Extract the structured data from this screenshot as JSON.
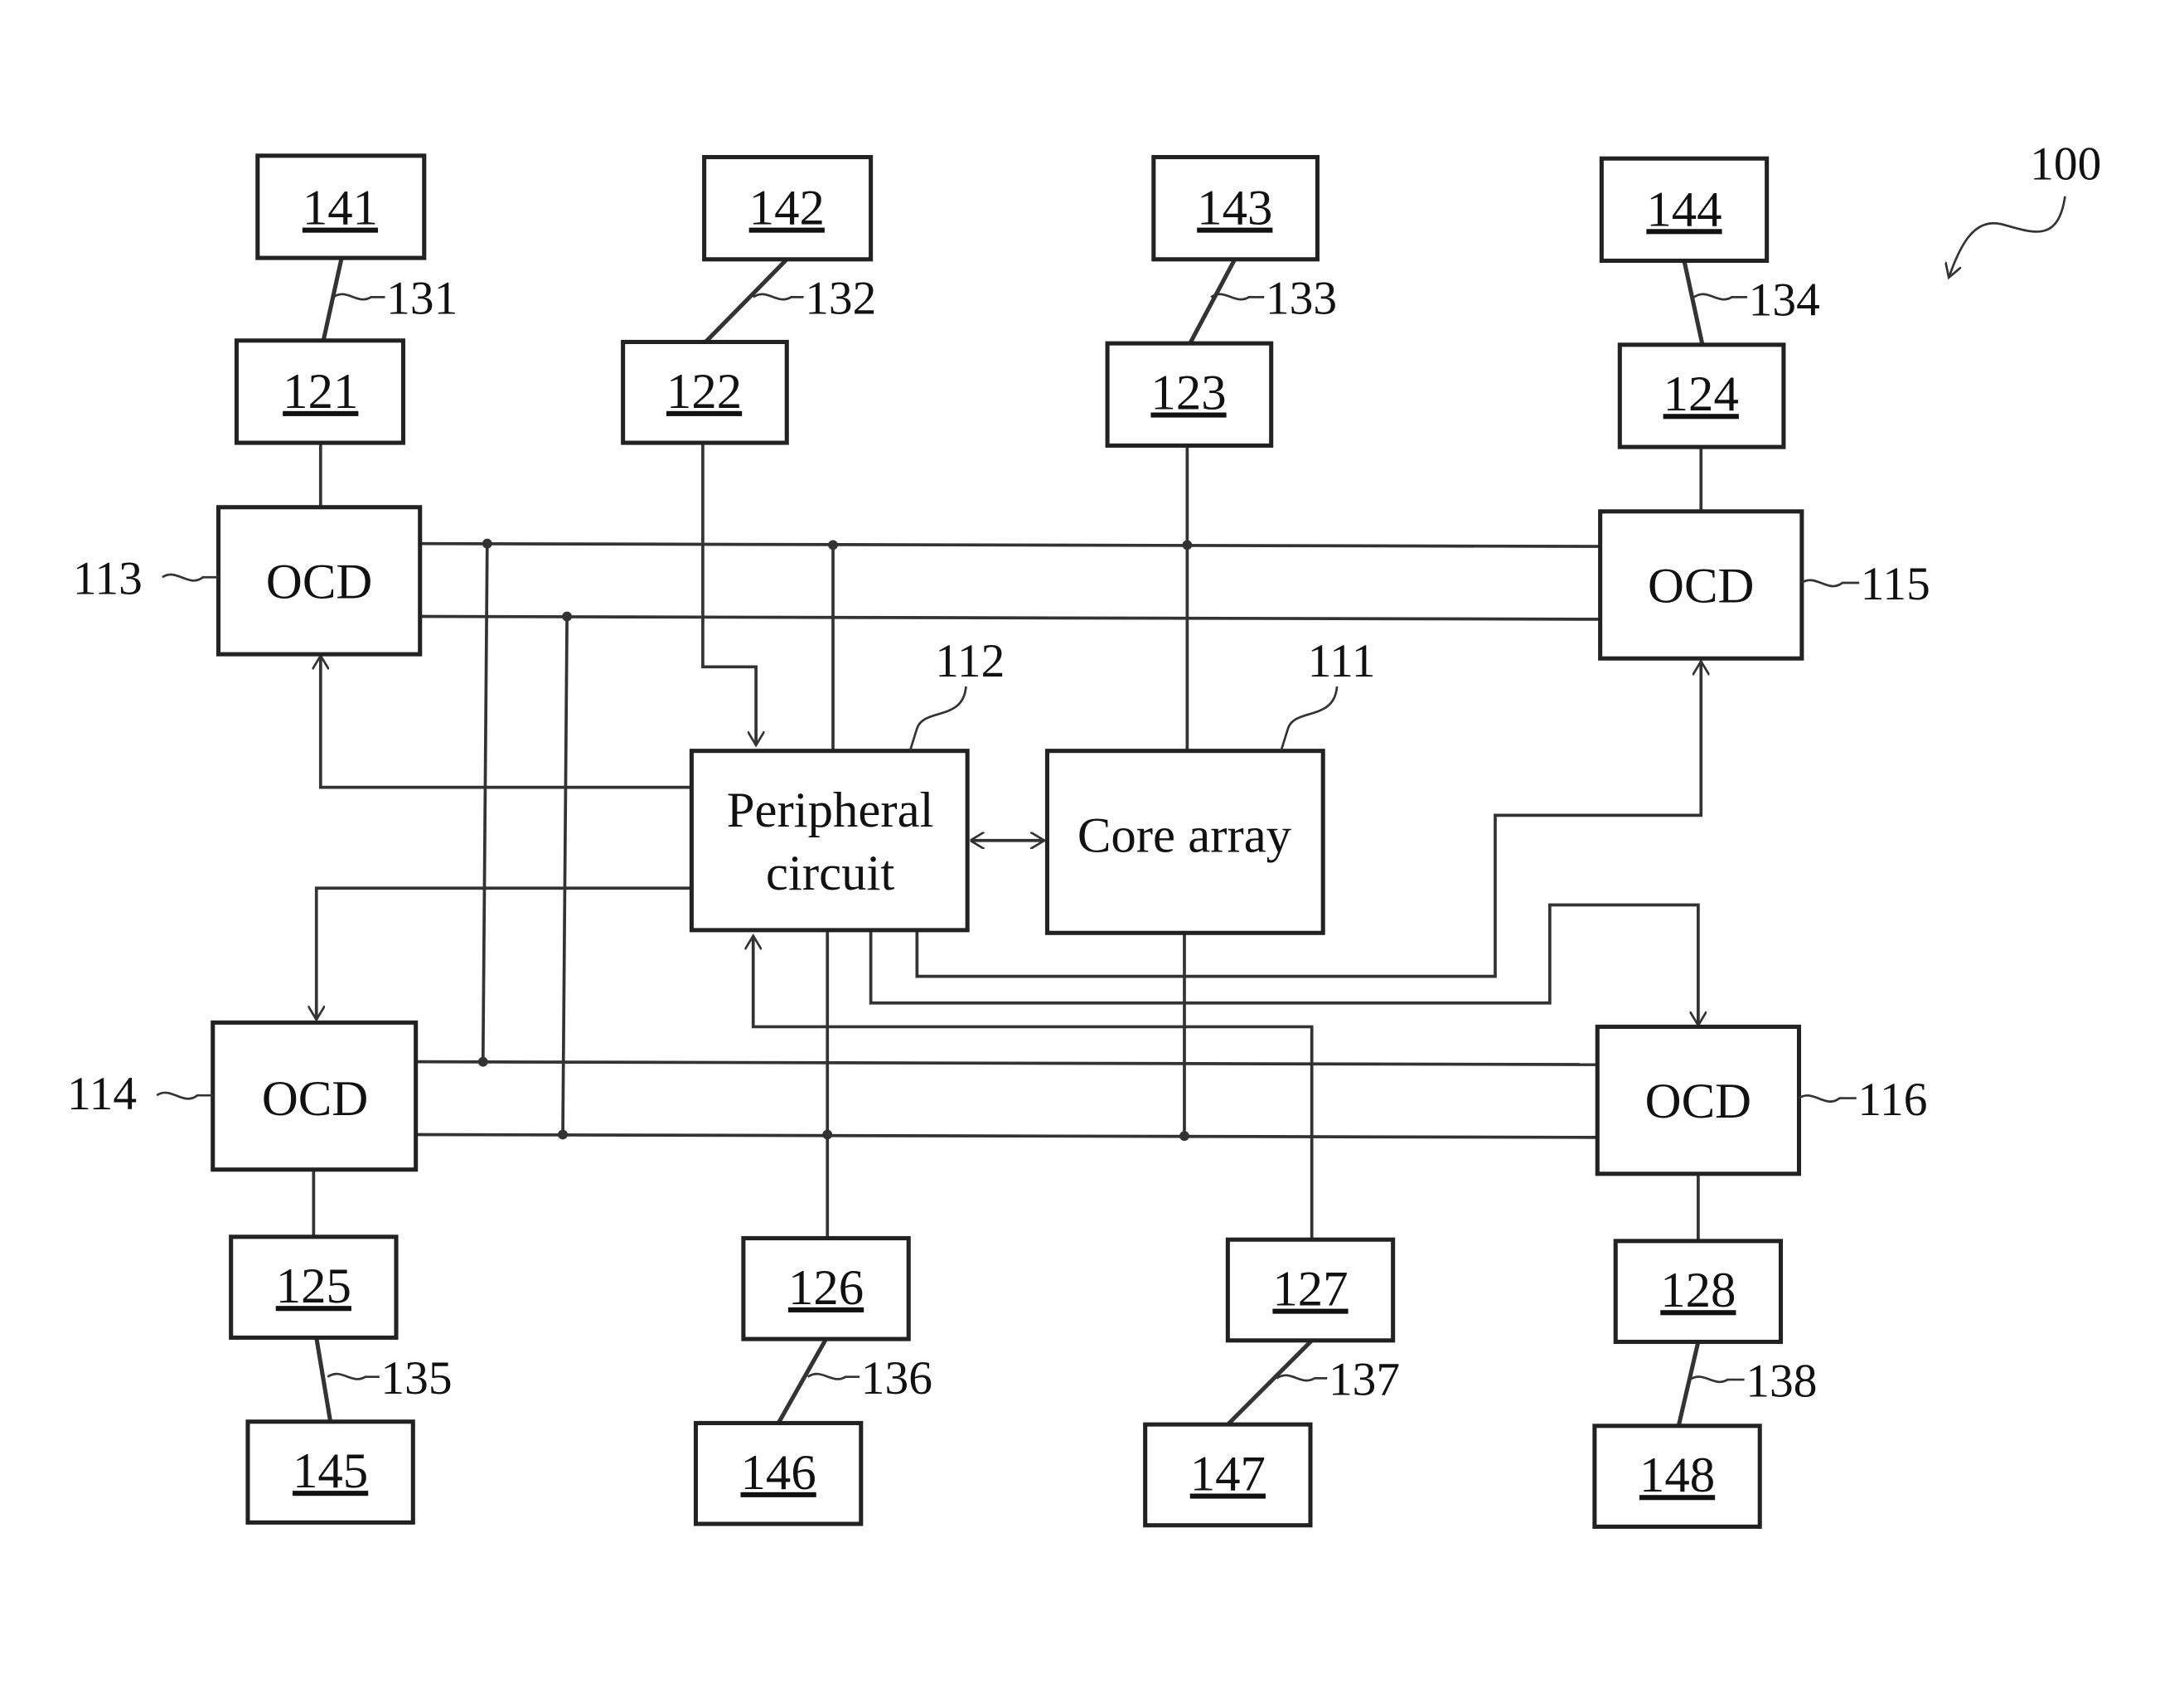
{
  "figure": {
    "reference": "100",
    "core": {
      "ref": "111",
      "label": "Core array"
    },
    "peripheral": {
      "ref": "112",
      "label_line1": "Peripheral",
      "label_line2": "circuit"
    },
    "ocds": [
      {
        "ref": "113",
        "label": "OCD"
      },
      {
        "ref": "114",
        "label": "OCD"
      },
      {
        "ref": "115",
        "label": "OCD"
      },
      {
        "ref": "116",
        "label": "OCD"
      }
    ],
    "pads": [
      "121",
      "122",
      "123",
      "124",
      "125",
      "126",
      "127",
      "128"
    ],
    "bond_wires": [
      "131",
      "132",
      "133",
      "134",
      "135",
      "136",
      "137",
      "138"
    ],
    "pins": [
      "141",
      "142",
      "143",
      "144",
      "145",
      "146",
      "147",
      "148"
    ]
  }
}
